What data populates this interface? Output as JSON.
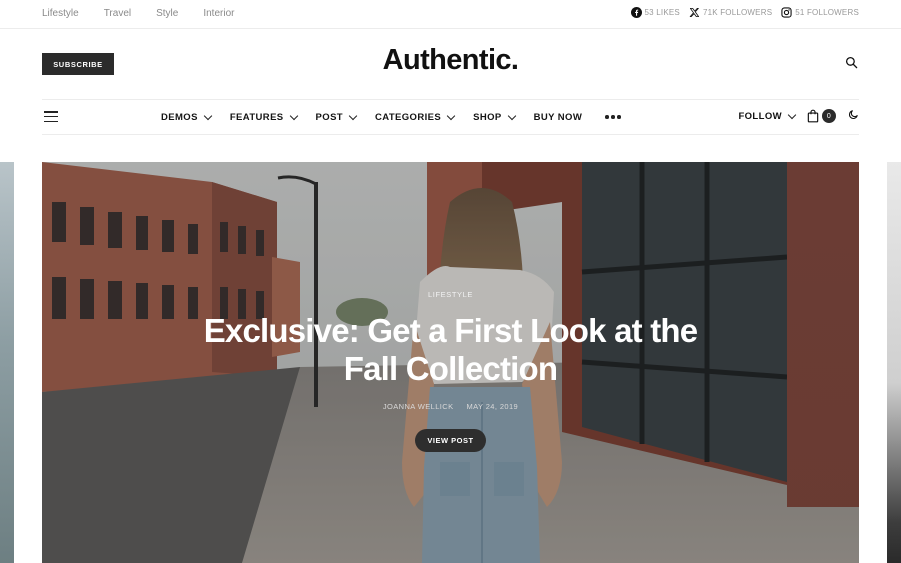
{
  "topbar": {
    "links": [
      "Lifestyle",
      "Travel",
      "Style",
      "Interior"
    ],
    "social": [
      {
        "icon": "facebook-icon",
        "label": "53 LIKES"
      },
      {
        "icon": "x-twitter-icon",
        "label": "71K FOLLOWERS"
      },
      {
        "icon": "instagram-icon",
        "label": "51 FOLLOWERS"
      }
    ]
  },
  "header": {
    "subscribe_label": "SUBSCRIBE",
    "logo": "Authentic.",
    "search_icon": "search-icon"
  },
  "nav": {
    "menu_icon": "hamburger-menu-icon",
    "items": [
      {
        "label": "DEMOS",
        "has_dropdown": true
      },
      {
        "label": "FEATURES",
        "has_dropdown": true
      },
      {
        "label": "POST",
        "has_dropdown": true
      },
      {
        "label": "CATEGORIES",
        "has_dropdown": true
      },
      {
        "label": "SHOP",
        "has_dropdown": true
      },
      {
        "label": "BUY NOW",
        "has_dropdown": false
      }
    ],
    "more_icon": "more-dots-icon",
    "follow_label": "FOLLOW",
    "cart_icon": "shopping-bag-icon",
    "cart_count": "0",
    "dark_mode_icon": "moon-icon"
  },
  "hero": {
    "category": "LIFESTYLE",
    "title": "Exclusive: Get a First Look at the Fall Collection",
    "author": "JOANNA WELLICK",
    "date": "MAY 24, 2019",
    "button_label": "VIEW POST"
  },
  "colors": {
    "text": "#111111",
    "muted": "#8a8a8a",
    "button_dark": "#2b2b2b",
    "border": "#ececec"
  }
}
